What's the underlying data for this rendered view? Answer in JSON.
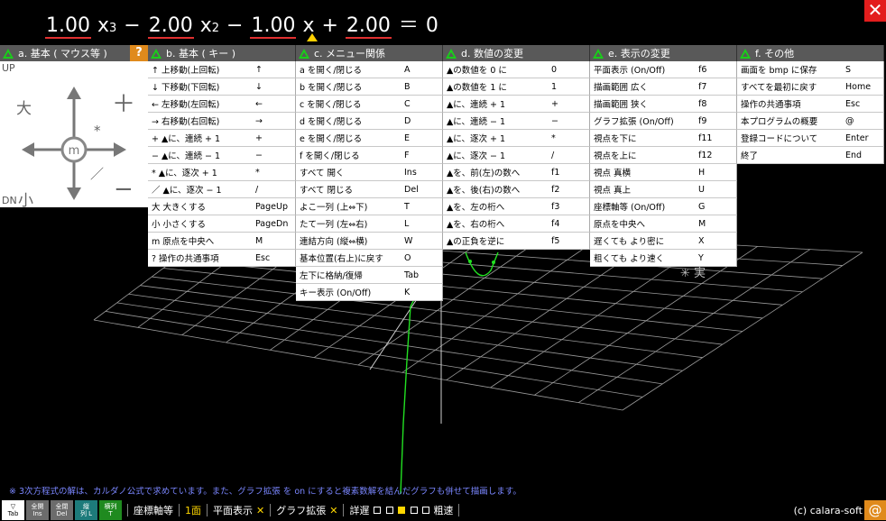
{
  "equation": {
    "coefficients": [
      "1.00",
      "2.00",
      "1.00",
      "2.00"
    ],
    "operators": [
      "−",
      "−",
      "+"
    ],
    "variable": "x",
    "exponents": [
      "3",
      "2"
    ],
    "equals": "＝",
    "rhs": "0"
  },
  "close_label": "✕",
  "panels": {
    "a": {
      "title": "a. 基本 ( マウス等 )",
      "help": "?",
      "up": "UP",
      "dn": "DN",
      "big": "大",
      "small": "小",
      "center": "m",
      "plus": "＋",
      "minus": "−",
      "star": "*",
      "slash": "／"
    },
    "b": {
      "title": "b. 基本 ( キー )",
      "rows": [
        {
          "label": "↑  上移動(上回転)",
          "key": "↑"
        },
        {
          "label": "↓  下移動(下回転)",
          "key": "↓"
        },
        {
          "label": "←  左移動(左回転)",
          "key": "←"
        },
        {
          "label": "→  右移動(右回転)",
          "key": "→"
        },
        {
          "label": "+  ▲に、連続 + 1",
          "key": "+"
        },
        {
          "label": "−  ▲に、連続 − 1",
          "key": "−"
        },
        {
          "label": "*  ▲に、逐次 + 1",
          "key": "*"
        },
        {
          "label": "／ ▲に、逐次 − 1",
          "key": "/"
        },
        {
          "label": "大  大きくする",
          "key": "PageUp"
        },
        {
          "label": "小  小さくする",
          "key": "PageDn"
        },
        {
          "label": "m  原点を中央へ",
          "key": "M"
        },
        {
          "label": "?  操作の共通事項",
          "key": "Esc"
        }
      ]
    },
    "c": {
      "title": "c. メニュー関係",
      "rows": [
        {
          "label": "a を開く/閉じる",
          "key": "A"
        },
        {
          "label": "b を開く/閉じる",
          "key": "B"
        },
        {
          "label": "c を開く/閉じる",
          "key": "C"
        },
        {
          "label": "d を開く/閉じる",
          "key": "D"
        },
        {
          "label": "e を開く/閉じる",
          "key": "E"
        },
        {
          "label": "f を開く/閉じる",
          "key": "F"
        },
        {
          "label": "すべて 開く",
          "key": "Ins"
        },
        {
          "label": "すべて 閉じる",
          "key": "Del"
        },
        {
          "label": "よこ一列 (上⇔下)",
          "key": "T"
        },
        {
          "label": "たて一列 (左⇔右)",
          "key": "L"
        },
        {
          "label": "連結方向 (縦⇔横)",
          "key": "W"
        },
        {
          "label": "基本位置(右上)に戻す",
          "key": "O"
        },
        {
          "label": "左下に格納/復帰",
          "key": "Tab"
        },
        {
          "label": "キー表示 (On/Off)",
          "key": "K"
        }
      ]
    },
    "d": {
      "title": "d. 数値の変更",
      "rows": [
        {
          "label": "▲の数値を 0 に",
          "key": "0"
        },
        {
          "label": "▲の数値を 1 に",
          "key": "1"
        },
        {
          "label": "▲に、連続 + 1",
          "key": "+"
        },
        {
          "label": "▲に、連続 − 1",
          "key": "−"
        },
        {
          "label": "▲に、逐次 + 1",
          "key": "*"
        },
        {
          "label": "▲に、逐次 − 1",
          "key": "/"
        },
        {
          "label": "▲を、前(左)の数へ",
          "key": "f1"
        },
        {
          "label": "▲を、後(右)の数へ",
          "key": "f2"
        },
        {
          "label": "▲を、左の桁へ",
          "key": "f3"
        },
        {
          "label": "▲を、右の桁へ",
          "key": "f4"
        },
        {
          "label": "▲の正負を逆に",
          "key": "f5"
        }
      ]
    },
    "e": {
      "title": "e. 表示の変更",
      "rows": [
        {
          "label": "平面表示 (On/Off)",
          "key": "f6"
        },
        {
          "label": "描画範囲  広く",
          "key": "f7"
        },
        {
          "label": "描画範囲  狭く",
          "key": "f8"
        },
        {
          "label": "グラフ拡張 (On/Off)",
          "key": "f9"
        },
        {
          "label": "視点を下に",
          "key": "f11"
        },
        {
          "label": "視点を上に",
          "key": "f12"
        },
        {
          "label": "視点  真横",
          "key": "H"
        },
        {
          "label": "視点  真上",
          "key": "U"
        },
        {
          "label": "座標軸等 (On/Off)",
          "key": "G"
        },
        {
          "label": "原点を中央へ",
          "key": "M"
        },
        {
          "label": "遅くても より密に",
          "key": "X"
        },
        {
          "label": "粗くても より速く",
          "key": "Y"
        }
      ]
    },
    "f": {
      "title": "f. その他",
      "rows": [
        {
          "label": "画面を bmp に保存",
          "key": "S"
        },
        {
          "label": "すべてを最初に戻す",
          "key": "Home"
        },
        {
          "label": "操作の共通事項",
          "key": "Esc"
        },
        {
          "label": "本プログラムの概要",
          "key": "@"
        },
        {
          "label": "登録コードについて",
          "key": "Enter"
        },
        {
          "label": "終了",
          "key": "End"
        }
      ]
    }
  },
  "scene_label": "✳ 実",
  "footnote": "※ 3次方程式の解は、カルダノ公式で求めています。また、グラフ拡張 を on にすると複素数解を結んだグラフも併せて描画します。",
  "status": {
    "btn_tab": [
      "▽",
      "Tab"
    ],
    "btn_ins": [
      "全開",
      "Ins"
    ],
    "btn_del": [
      "全閉",
      "Del"
    ],
    "btn_l": [
      "縦",
      "列 L"
    ],
    "btn_t": [
      "横列",
      "T"
    ],
    "axes": "座標軸等",
    "face": "1面",
    "plane": "平面表示",
    "plane_x": "✕",
    "expand": "グラフ拡張",
    "expand_x": "✕",
    "slow": "詳遅",
    "fast": "粗速",
    "copyright": "(c) calara-soft",
    "at": "@"
  },
  "colors": {
    "panel_header": "#595959",
    "triangle": "#19d019",
    "accent_orange": "#e08a1c",
    "close_red": "#e31d1d",
    "coef_underline": "#e03030",
    "footnote": "#7a86ff",
    "curve": "#22e022"
  }
}
